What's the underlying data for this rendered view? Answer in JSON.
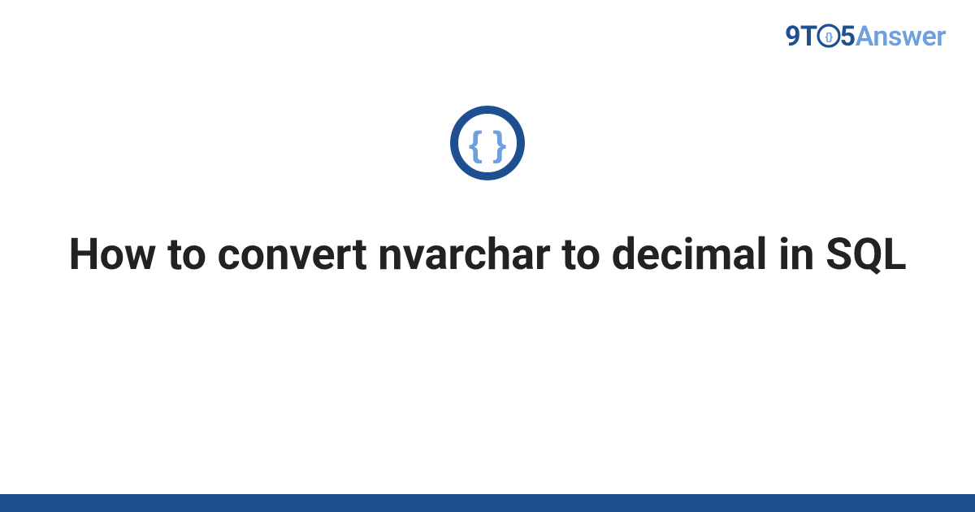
{
  "brand": {
    "part_9t": "9T",
    "part_5": "5",
    "part_answer": "Answer"
  },
  "main": {
    "title": "How to convert nvarchar to decimal in SQL"
  },
  "colors": {
    "brand_dark": "#1d4f91",
    "brand_light": "#6ea0de",
    "text": "#222222"
  }
}
